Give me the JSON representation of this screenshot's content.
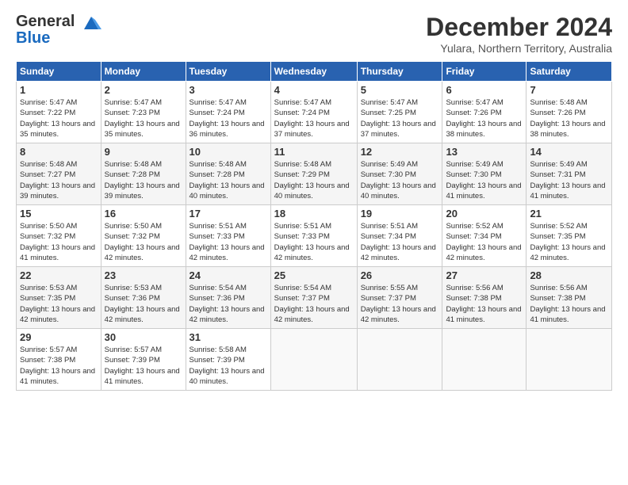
{
  "header": {
    "logo_line1": "General",
    "logo_line2": "Blue",
    "month_year": "December 2024",
    "location": "Yulara, Northern Territory, Australia"
  },
  "weekdays": [
    "Sunday",
    "Monday",
    "Tuesday",
    "Wednesday",
    "Thursday",
    "Friday",
    "Saturday"
  ],
  "weeks": [
    [
      {
        "day": "1",
        "sunrise": "5:47 AM",
        "sunset": "7:22 PM",
        "daylight": "13 hours and 35 minutes."
      },
      {
        "day": "2",
        "sunrise": "5:47 AM",
        "sunset": "7:23 PM",
        "daylight": "13 hours and 35 minutes."
      },
      {
        "day": "3",
        "sunrise": "5:47 AM",
        "sunset": "7:24 PM",
        "daylight": "13 hours and 36 minutes."
      },
      {
        "day": "4",
        "sunrise": "5:47 AM",
        "sunset": "7:24 PM",
        "daylight": "13 hours and 37 minutes."
      },
      {
        "day": "5",
        "sunrise": "5:47 AM",
        "sunset": "7:25 PM",
        "daylight": "13 hours and 37 minutes."
      },
      {
        "day": "6",
        "sunrise": "5:47 AM",
        "sunset": "7:26 PM",
        "daylight": "13 hours and 38 minutes."
      },
      {
        "day": "7",
        "sunrise": "5:48 AM",
        "sunset": "7:26 PM",
        "daylight": "13 hours and 38 minutes."
      }
    ],
    [
      {
        "day": "8",
        "sunrise": "5:48 AM",
        "sunset": "7:27 PM",
        "daylight": "13 hours and 39 minutes."
      },
      {
        "day": "9",
        "sunrise": "5:48 AM",
        "sunset": "7:28 PM",
        "daylight": "13 hours and 39 minutes."
      },
      {
        "day": "10",
        "sunrise": "5:48 AM",
        "sunset": "7:28 PM",
        "daylight": "13 hours and 40 minutes."
      },
      {
        "day": "11",
        "sunrise": "5:48 AM",
        "sunset": "7:29 PM",
        "daylight": "13 hours and 40 minutes."
      },
      {
        "day": "12",
        "sunrise": "5:49 AM",
        "sunset": "7:30 PM",
        "daylight": "13 hours and 40 minutes."
      },
      {
        "day": "13",
        "sunrise": "5:49 AM",
        "sunset": "7:30 PM",
        "daylight": "13 hours and 41 minutes."
      },
      {
        "day": "14",
        "sunrise": "5:49 AM",
        "sunset": "7:31 PM",
        "daylight": "13 hours and 41 minutes."
      }
    ],
    [
      {
        "day": "15",
        "sunrise": "5:50 AM",
        "sunset": "7:32 PM",
        "daylight": "13 hours and 41 minutes."
      },
      {
        "day": "16",
        "sunrise": "5:50 AM",
        "sunset": "7:32 PM",
        "daylight": "13 hours and 42 minutes."
      },
      {
        "day": "17",
        "sunrise": "5:51 AM",
        "sunset": "7:33 PM",
        "daylight": "13 hours and 42 minutes."
      },
      {
        "day": "18",
        "sunrise": "5:51 AM",
        "sunset": "7:33 PM",
        "daylight": "13 hours and 42 minutes."
      },
      {
        "day": "19",
        "sunrise": "5:51 AM",
        "sunset": "7:34 PM",
        "daylight": "13 hours and 42 minutes."
      },
      {
        "day": "20",
        "sunrise": "5:52 AM",
        "sunset": "7:34 PM",
        "daylight": "13 hours and 42 minutes."
      },
      {
        "day": "21",
        "sunrise": "5:52 AM",
        "sunset": "7:35 PM",
        "daylight": "13 hours and 42 minutes."
      }
    ],
    [
      {
        "day": "22",
        "sunrise": "5:53 AM",
        "sunset": "7:35 PM",
        "daylight": "13 hours and 42 minutes."
      },
      {
        "day": "23",
        "sunrise": "5:53 AM",
        "sunset": "7:36 PM",
        "daylight": "13 hours and 42 minutes."
      },
      {
        "day": "24",
        "sunrise": "5:54 AM",
        "sunset": "7:36 PM",
        "daylight": "13 hours and 42 minutes."
      },
      {
        "day": "25",
        "sunrise": "5:54 AM",
        "sunset": "7:37 PM",
        "daylight": "13 hours and 42 minutes."
      },
      {
        "day": "26",
        "sunrise": "5:55 AM",
        "sunset": "7:37 PM",
        "daylight": "13 hours and 42 minutes."
      },
      {
        "day": "27",
        "sunrise": "5:56 AM",
        "sunset": "7:38 PM",
        "daylight": "13 hours and 41 minutes."
      },
      {
        "day": "28",
        "sunrise": "5:56 AM",
        "sunset": "7:38 PM",
        "daylight": "13 hours and 41 minutes."
      }
    ],
    [
      {
        "day": "29",
        "sunrise": "5:57 AM",
        "sunset": "7:38 PM",
        "daylight": "13 hours and 41 minutes."
      },
      {
        "day": "30",
        "sunrise": "5:57 AM",
        "sunset": "7:39 PM",
        "daylight": "13 hours and 41 minutes."
      },
      {
        "day": "31",
        "sunrise": "5:58 AM",
        "sunset": "7:39 PM",
        "daylight": "13 hours and 40 minutes."
      },
      null,
      null,
      null,
      null
    ]
  ]
}
